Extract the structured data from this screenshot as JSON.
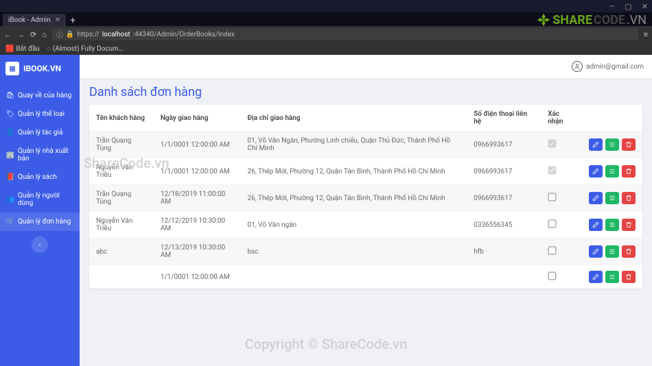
{
  "browser": {
    "tab_title": "iBook - Admin",
    "url_scheme": "https://",
    "url_host": "localhost",
    "url_port_path": ":44340/Admin/OrderBooks/Index",
    "bookmarks": [
      "Bắt đầu",
      "(Almost) Fully Docum…"
    ]
  },
  "watermark": {
    "logo_text_a": "SHARE",
    "logo_text_b": "CODE",
    "logo_text_c": ".VN",
    "mid_text": "ShareCode.vn",
    "bottom_text": "Copyright © ShareCode.vn"
  },
  "sidebar": {
    "brand": "IBOOK.VN",
    "items": [
      {
        "label": "Quay về của hàng"
      },
      {
        "label": "Quản lý thể loại"
      },
      {
        "label": "Quản lý tác giả"
      },
      {
        "label": "Quản lý nhà xuất bản"
      },
      {
        "label": "Quản lý sách"
      },
      {
        "label": "Quản lý người dùng"
      },
      {
        "label": "Quản lý đơn hàng"
      }
    ]
  },
  "topbar": {
    "user_email": "admin@gmail.com"
  },
  "page": {
    "title": "Danh sách đơn hàng"
  },
  "table": {
    "headers": {
      "customer": "Tên khách hàng",
      "date": "Ngày giao hàng",
      "address": "Địa chỉ giao hàng",
      "phone": "Số điện thoại liên hệ",
      "confirm": "Xác nhận"
    },
    "rows": [
      {
        "customer": "Trần Quang Tùng",
        "date": "1/1/0001 12:00:00 AM",
        "address": "01, Võ Văn Ngân, Phường Linh chiểu, Quận Thủ Đức, Thành Phố Hồ Chí Minh",
        "phone": "0966993617",
        "confirm": true,
        "disabled": true
      },
      {
        "customer": "Nguyễn Văn Triều",
        "date": "1/1/0001 12:00:00 AM",
        "address": "26, Thép Mới, Phường 12, Quận Tân Bình, Thành Phố Hồ Chí Minh",
        "phone": "0966993617",
        "confirm": true,
        "disabled": true
      },
      {
        "customer": "Trần Quang Tùng",
        "date": "12/18/2019 11:00:00 AM",
        "address": "26, Thép Mới, Phường 12, Quận Tân Bình, Thành Phố Hồ Chí Minh",
        "phone": "0966993617",
        "confirm": false,
        "disabled": false
      },
      {
        "customer": "Nguyễn Văn Triều",
        "date": "12/12/2019 10:30:00 AM",
        "address": "01, Võ Văn ngân",
        "phone": "0336556345",
        "confirm": false,
        "disabled": false
      },
      {
        "customer": "abc",
        "date": "12/13/2019 10:30:00 AM",
        "address": "bsc",
        "phone": "hfb",
        "confirm": false,
        "disabled": false
      },
      {
        "customer": "",
        "date": "1/1/0001 12:00:00 AM",
        "address": "",
        "phone": "",
        "confirm": false,
        "disabled": false
      }
    ]
  }
}
